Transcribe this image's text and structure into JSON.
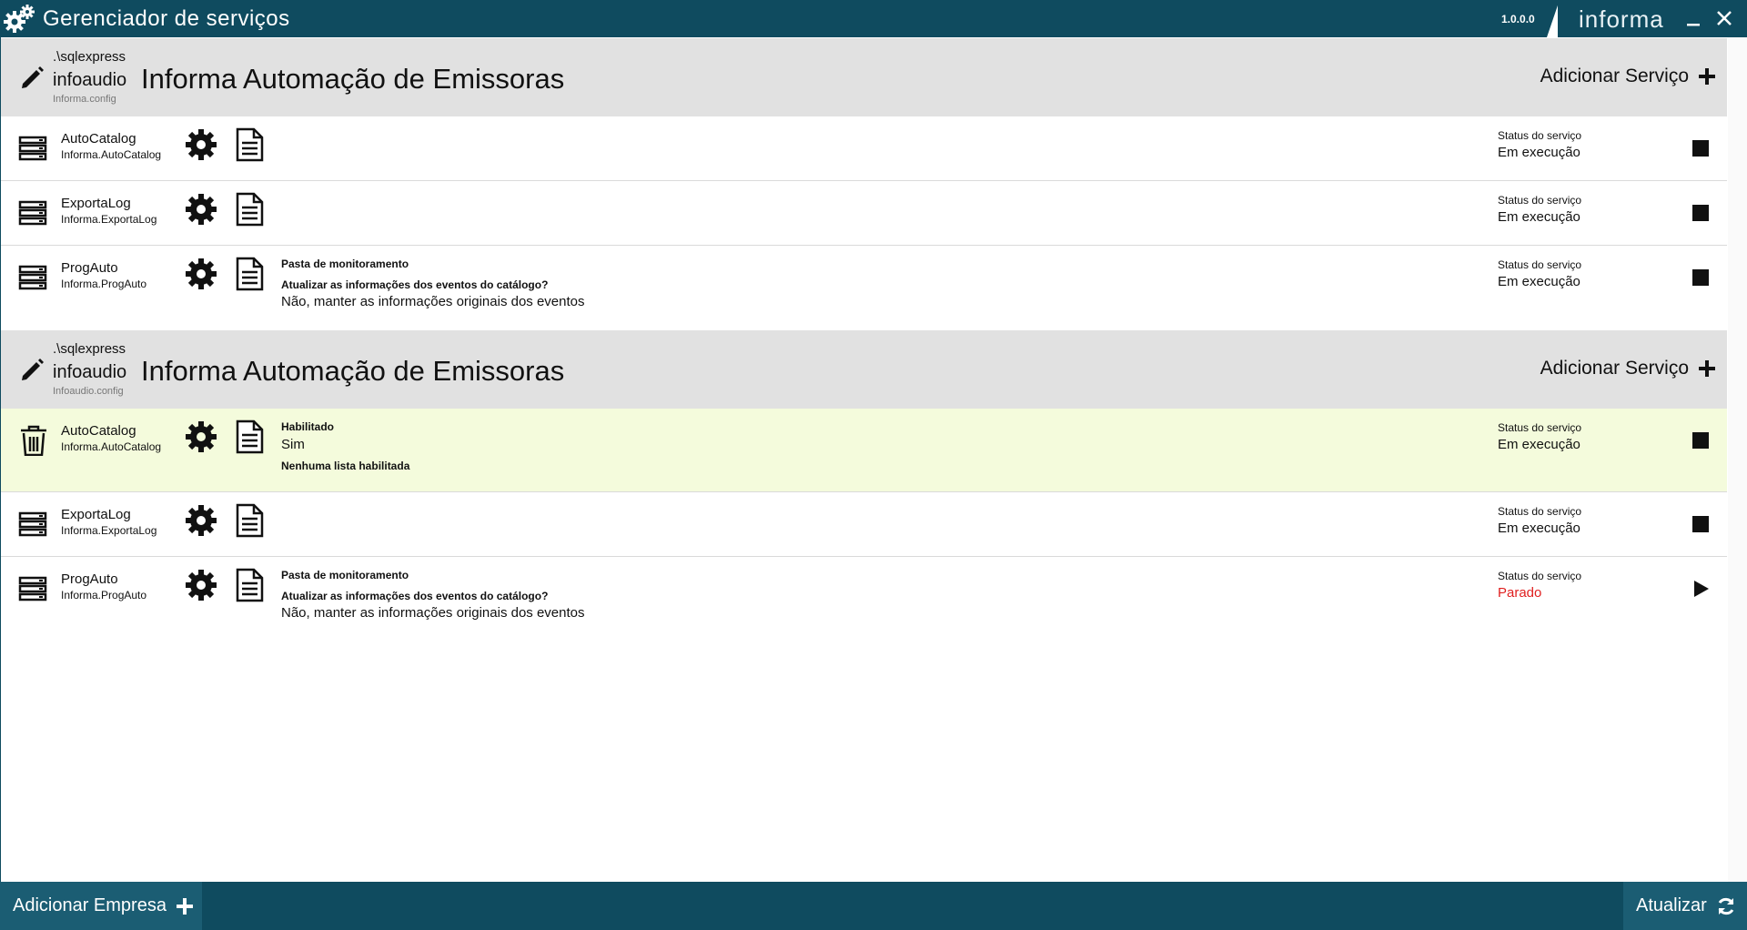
{
  "window": {
    "title": "Gerenciador de serviços",
    "version": "1.0.0.0",
    "brand": "informa",
    "colors": {
      "titlebar": "#0f4b5f",
      "selected_row": "#f4fbdc",
      "stopped": "#e02020"
    }
  },
  "companies": [
    {
      "server": ".\\sqlexpress",
      "db": "infoaudio",
      "config": "Informa.config",
      "name": "Informa Automação de Emissoras",
      "add_service_label": "Adicionar Serviço",
      "services": [
        {
          "name": "AutoCatalog",
          "id": "Informa.AutoCatalog",
          "status_label": "Status do serviço",
          "status": "Em execução",
          "action": "stop",
          "row_icon": "server-icon"
        },
        {
          "name": "ExportaLog",
          "id": "Informa.ExportaLog",
          "status_label": "Status do serviço",
          "status": "Em execução",
          "action": "stop",
          "row_icon": "server-icon"
        },
        {
          "name": "ProgAuto",
          "id": "Informa.ProgAuto",
          "status_label": "Status do serviço",
          "status": "Em execução",
          "action": "stop",
          "row_icon": "server-icon",
          "details": [
            "Pasta de monitoramento",
            "Atualizar as informações dos eventos do catálogo?",
            "Não, manter as informações originais dos eventos"
          ]
        }
      ]
    },
    {
      "server": ".\\sqlexpress",
      "db": "infoaudio",
      "config": "Infoaudio.config",
      "name": "Informa Automação de Emissoras",
      "add_service_label": "Adicionar Serviço",
      "services": [
        {
          "name": "AutoCatalog",
          "id": "Informa.AutoCatalog",
          "status_label": "Status do serviço",
          "status": "Em execução",
          "action": "stop",
          "row_icon": "trash-icon",
          "selected": true,
          "details": [
            "Habilitado",
            "Sim",
            "Nenhuma lista habilitada"
          ]
        },
        {
          "name": "ExportaLog",
          "id": "Informa.ExportaLog",
          "status_label": "Status do serviço",
          "status": "Em execução",
          "action": "stop",
          "row_icon": "server-icon"
        },
        {
          "name": "ProgAuto",
          "id": "Informa.ProgAuto",
          "status_label": "Status do serviço",
          "status": "Parado",
          "action": "play",
          "row_icon": "server-icon",
          "details": [
            "Pasta de monitoramento",
            "Atualizar as informações dos eventos do catálogo?",
            "Não, manter as informações originais dos eventos"
          ]
        }
      ]
    }
  ],
  "footer": {
    "add_company_label": "Adicionar Empresa",
    "refresh_label": "Atualizar"
  }
}
